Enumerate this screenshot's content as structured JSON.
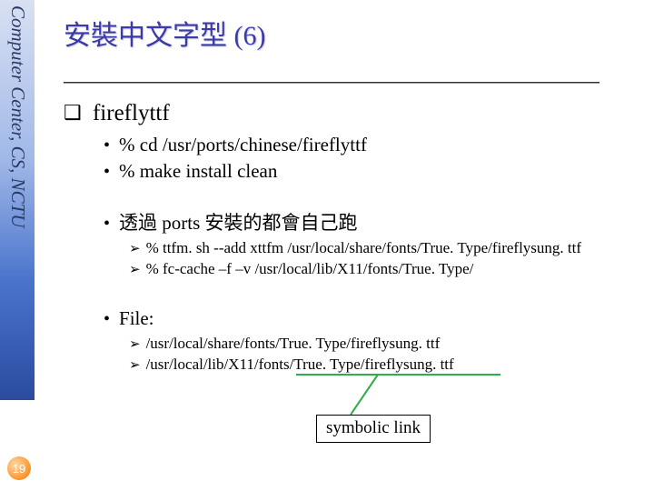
{
  "sidebar": {
    "label": "Computer Center, CS, NCTU"
  },
  "page_number": "19",
  "title": "安裝中文字型 (6)",
  "h1": "fireflyttf",
  "b1_items": [
    "% cd /usr/ports/chinese/fireflyttf",
    "% make install clean"
  ],
  "b2": "透過 ports 安裝的都會自己跑",
  "b2_sub": [
    "% ttfm. sh --add xttfm /usr/local/share/fonts/True. Type/fireflysung. ttf",
    "% fc-cache –f –v /usr/local/lib/X11/fonts/True. Type/"
  ],
  "b3": "File:",
  "b3_sub": [
    "/usr/local/share/fonts/True. Type/fireflysung. ttf",
    "/usr/local/lib/X11/fonts/True. Type/fireflysung. ttf"
  ],
  "symbolic_link": "symbolic link"
}
